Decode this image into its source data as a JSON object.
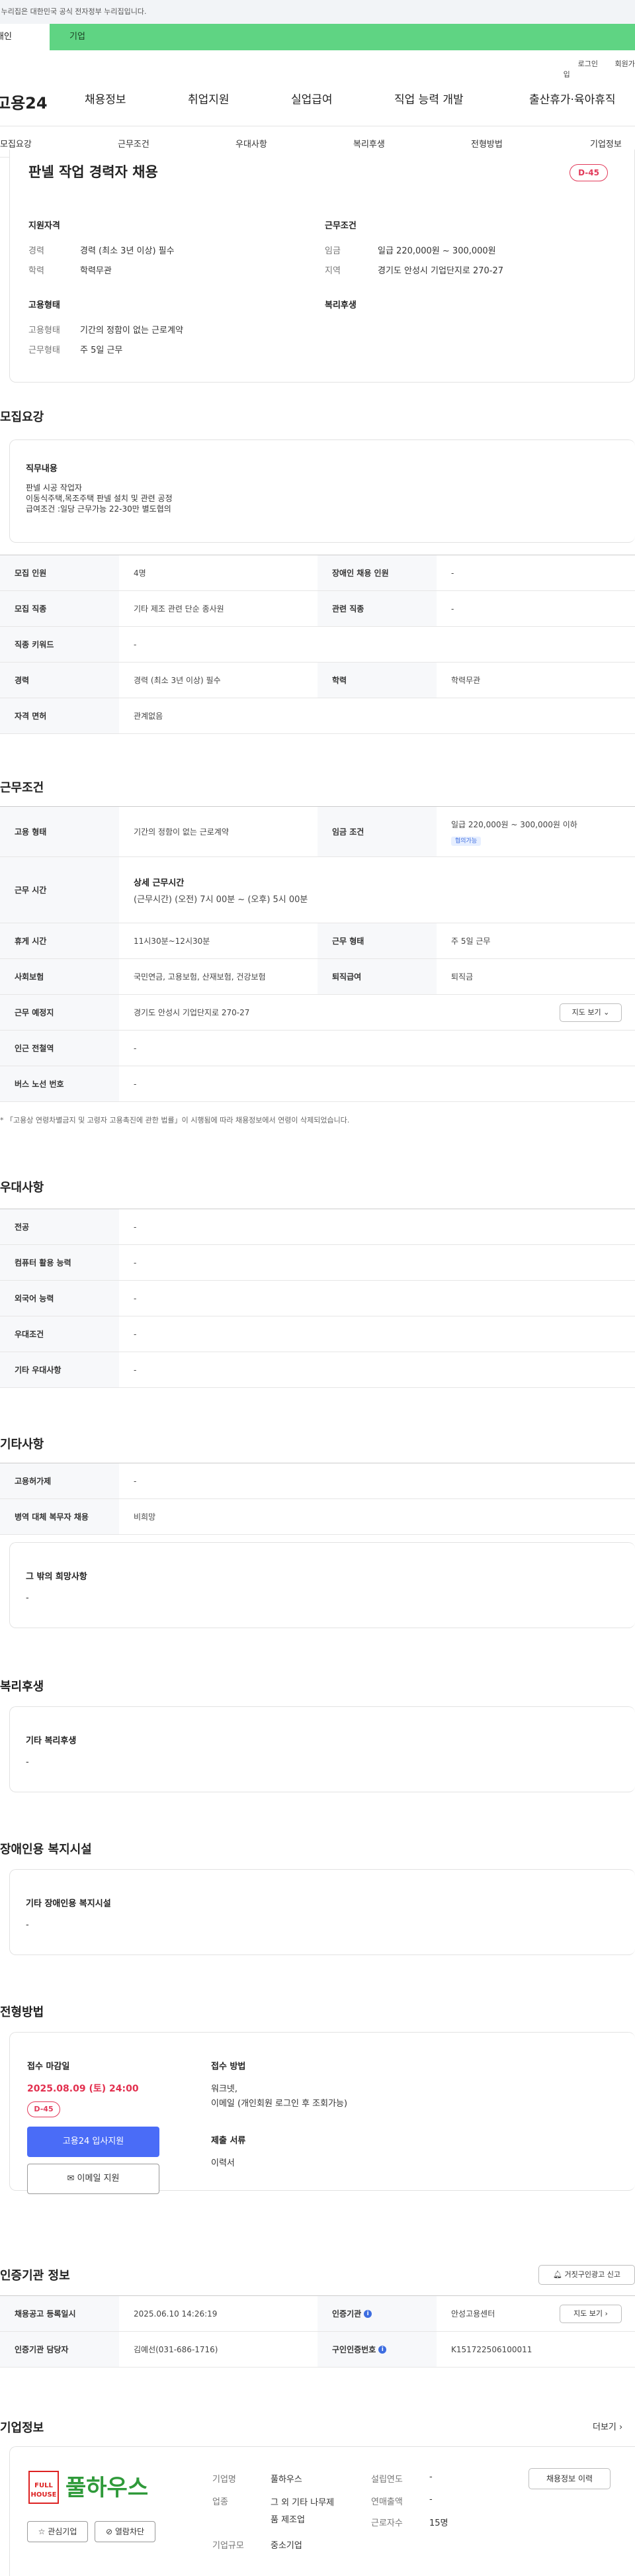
{
  "header": {
    "gov_notice": "이 누리집은 대한민국 공식 전자정부 누리집입니다.",
    "tab_person": "개인",
    "tab_company": "기업",
    "util": [
      "로그인",
      "회원가입"
    ],
    "logo": "고용24",
    "gnb": [
      "채용정보",
      "취업지원",
      "실업급여",
      "직업 능력 개발",
      "출산휴가·육아휴직"
    ]
  },
  "subnav": [
    "모집요강",
    "근무조건",
    "우대사항",
    "복리후생",
    "전형방법",
    "기업정보"
  ],
  "summary": {
    "title": "판넬 작업 경력자 채용",
    "dday": "D-45",
    "qual_h": "지원자격",
    "career_l": "경력",
    "career_v": "경력 (최소 3년 이상) 필수",
    "edu_l": "학력",
    "edu_v": "학력무관",
    "emp_h": "고용형태",
    "emp_l": "고용형태",
    "emp_v": "기간의 정함이 없는 근로계약",
    "work_l": "근무형태",
    "work_v": "주 5일 근무",
    "cond_h": "근무조건",
    "wage_l": "임금",
    "wage_v": "일급 220,000원 ~ 300,000원",
    "area_l": "지역",
    "area_v": "경기도 안성시 기업단지로 270-27",
    "welfare_h": "복리후생"
  },
  "recruit": {
    "heading": "모집요강",
    "duty_h": "직무내용",
    "duty_lines": [
      "판넬 시공 작업자",
      "이동식주택,목조주택 판넬 설치 및 관련 공정",
      "급여조건 :일당 근무가능 22-30만 별도협의"
    ],
    "rows": {
      "headcount_l": "모집 인원",
      "headcount_v": "4명",
      "disabled_l": "장애인 채용 인원",
      "disabled_v": "-",
      "job_l": "모집 직종",
      "job_v": "기타 제조 관련 단순 종사원",
      "rel_l": "관련 직종",
      "rel_v": "-",
      "kw_l": "직종 키워드",
      "kw_v": "-",
      "career_l": "경력",
      "career_v": "경력 (최소 3년 이상) 필수",
      "edu_l": "학력",
      "edu_v": "학력무관",
      "lic_l": "자격 면허",
      "lic_v": "관계없음"
    }
  },
  "conditions": {
    "heading": "근무조건",
    "emp_l": "고용 형태",
    "emp_v": "기간의 정함이 없는 근로계약",
    "wage_l": "임금 조건",
    "wage_v": "일급 220,000원 ~ 300,000원 이하",
    "wage_badge": "협의가능",
    "time_l": "근무 시간",
    "time_h": "상세 근무시간",
    "time_v": "(근무시간) (오전) 7시 00분 ~ (오후) 5시 00분",
    "break_l": "휴게 시간",
    "break_v": "11시30분~12시30분",
    "form_l": "근무 형태",
    "form_v": "주 5일 근무",
    "ins_l": "사회보험",
    "ins_v": "국민연금, 고용보험, 산재보험, 건강보험",
    "sev_l": "퇴직급여",
    "sev_v": "퇴직금",
    "place_l": "근무 예정지",
    "place_v": "경기도 안성시 기업단지로 270-27",
    "map_btn": "지도 보기",
    "subway_l": "인근 전철역",
    "subway_v": "-",
    "bus_l": "버스 노선 번호",
    "bus_v": "-",
    "note": "* 「고용상 연령차별금지 및 고령자 고용촉진에 관한 법률」이 시행됨에 따라 채용정보에서 연령이 삭제되었습니다."
  },
  "preference": {
    "heading": "우대사항",
    "major_l": "전공",
    "major_v": "-",
    "pc_l": "컴퓨터 활용 능력",
    "pc_v": "-",
    "lang_l": "외국어 능력",
    "lang_v": "-",
    "cond_l": "우대조건",
    "cond_v": "-",
    "etc_l": "기타 우대사항",
    "etc_v": "-"
  },
  "others": {
    "heading": "기타사항",
    "permit_l": "고용허가제",
    "permit_v": "-",
    "mil_l": "병역 대체 복무자 채용",
    "mil_v": "비희망",
    "wish_h": "그 밖의 희망사항",
    "wish_v": "-"
  },
  "welfare": {
    "heading": "복리후생",
    "h": "기타 복리후생",
    "v": "-"
  },
  "facility": {
    "heading": "장애인용 복지시설",
    "h": "기타 장애인용 복지시설",
    "v": "-"
  },
  "selection": {
    "heading": "전형방법",
    "deadline_h": "접수 마감일",
    "deadline_v": "2025.08.09 (토) 24:00",
    "dday": "D-45",
    "apply_btn": "고용24 입사지원",
    "email_btn": "이메일 지원",
    "method_h": "접수 방법",
    "method_v1": "워크넷,",
    "method_v2": "이메일 (개인회원 로그인 후 조회가능)",
    "docs_h": "제출 서류",
    "docs_v": "이력서"
  },
  "cert": {
    "heading": "인증기관 정보",
    "report_btn": "거짓구인광고 신고",
    "reg_l": "채용공고 등록일시",
    "reg_v": "2025.06.10 14:26:19",
    "org_l": "인증기관",
    "org_v": "안성고용센터",
    "map_btn": "지도 보기",
    "mgr_l": "인증기관 담당자",
    "mgr_v": "김예선(031-686-1716)",
    "no_l": "구인인증번호",
    "no_v": "K151722506100011"
  },
  "company": {
    "heading": "기업정보",
    "more": "더보기",
    "logo_text": "풀하우스",
    "logo_small_1": "FULL",
    "logo_small_2": "HOUSE",
    "fav_btn": "관심기업",
    "block_btn": "열람차단",
    "name_l": "기업명",
    "name_v": "풀하우스",
    "ind_l": "업종",
    "ind_v1": "그 외 기타 나무제",
    "ind_v2": "품 제조업",
    "size_l": "기업규모",
    "size_v": "중소기업",
    "year_l": "설립연도",
    "year_v": "-",
    "sales_l": "연매출액",
    "sales_v": "-",
    "emp_l": "근로자수",
    "emp_v": "15명",
    "history_btn": "채용정보 이력"
  }
}
